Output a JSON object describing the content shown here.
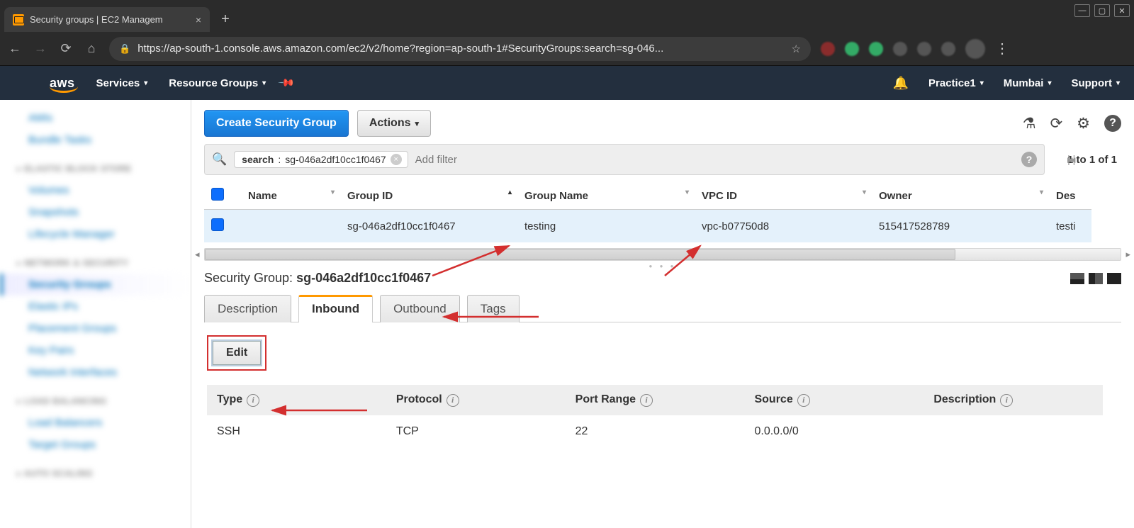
{
  "browser": {
    "tab_title": "Security groups | EC2 Managem",
    "url_display": "https://ap-south-1.console.aws.amazon.com/ec2/v2/home?region=ap-south-1#SecurityGroups:search=sg-046..."
  },
  "aws_header": {
    "services": "Services",
    "resource_groups": "Resource Groups",
    "account": "Practice1",
    "region": "Mumbai",
    "support": "Support"
  },
  "sidebar": {
    "s1_items": [
      "AMIs",
      "Bundle Tasks"
    ],
    "s2_head": "ELASTIC BLOCK STORE",
    "s2_items": [
      "Volumes",
      "Snapshots",
      "Lifecycle Manager"
    ],
    "s3_head": "NETWORK & SECURITY",
    "s3_items": [
      "Security Groups",
      "Elastic IPs",
      "Placement Groups",
      "Key Pairs",
      "Network Interfaces"
    ],
    "s4_head": "LOAD BALANCING",
    "s4_items": [
      "Load Balancers",
      "Target Groups"
    ],
    "s5_head": "AUTO SCALING"
  },
  "toolbar": {
    "create": "Create Security Group",
    "actions": "Actions"
  },
  "filter": {
    "chip_key": "search",
    "chip_value": "sg-046a2df10cc1f0467",
    "placeholder": "Add filter",
    "page_text": "1 to 1 of 1"
  },
  "columns": {
    "name": "Name",
    "group_id": "Group ID",
    "group_name": "Group Name",
    "vpc_id": "VPC ID",
    "owner": "Owner",
    "description": "Des"
  },
  "row": {
    "name": "",
    "group_id": "sg-046a2df10cc1f0467",
    "group_name": "testing",
    "vpc_id": "vpc-b07750d8",
    "owner": "515417528789",
    "description": "testi"
  },
  "detail_title_prefix": "Security Group: ",
  "detail_title_value": "sg-046a2df10cc1f0467",
  "tabs": {
    "description": "Description",
    "inbound": "Inbound",
    "outbound": "Outbound",
    "tags": "Tags"
  },
  "edit_label": "Edit",
  "rules_columns": {
    "type": "Type",
    "protocol": "Protocol",
    "port_range": "Port Range",
    "source": "Source",
    "description": "Description"
  },
  "rules_row": {
    "type": "SSH",
    "protocol": "TCP",
    "port_range": "22",
    "source": "0.0.0.0/0",
    "description": ""
  }
}
